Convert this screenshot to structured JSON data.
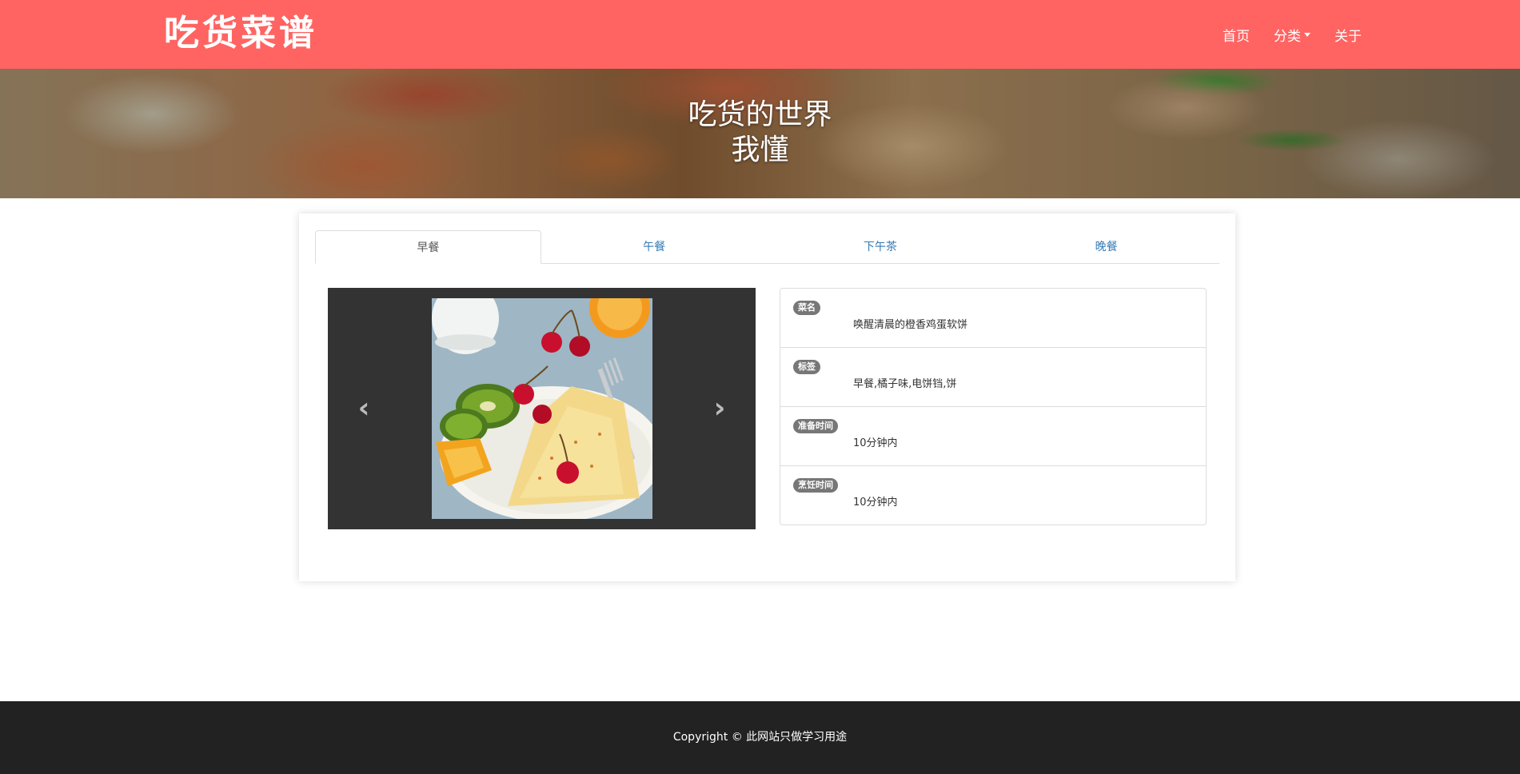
{
  "navbar": {
    "brand": "吃货菜谱",
    "links": [
      {
        "label": "首页"
      },
      {
        "label": "分类",
        "has_caret": true
      },
      {
        "label": "关于"
      }
    ]
  },
  "hero": {
    "title_line1": "吃货的世界",
    "title_line2": "我懂"
  },
  "tabs": [
    {
      "label": "早餐",
      "active": true
    },
    {
      "label": "午餐",
      "active": false
    },
    {
      "label": "下午茶",
      "active": false
    },
    {
      "label": "晚餐",
      "active": false
    }
  ],
  "carousel": {
    "prev_icon": "chevron-left-icon",
    "next_icon": "chevron-right-icon",
    "image": "crepe-with-cherries-kiwi-orange"
  },
  "recipe": {
    "name_label": "菜名",
    "name_value": "唤醒清晨的橙香鸡蛋软饼",
    "tags_label": "标签",
    "tags_value": "早餐,橘子味,电饼铛,饼",
    "prep_label": "准备时间",
    "prep_value": "10分钟内",
    "cook_label": "烹饪时间",
    "cook_value": "10分钟内"
  },
  "footer": {
    "text": "Copyright © 此网站只做学习用途"
  },
  "colors": {
    "navbar_bg": "#ff6462",
    "footer_bg": "#222222",
    "carousel_bg": "#333333",
    "badge_bg": "#777777",
    "link": "#337ab7"
  }
}
